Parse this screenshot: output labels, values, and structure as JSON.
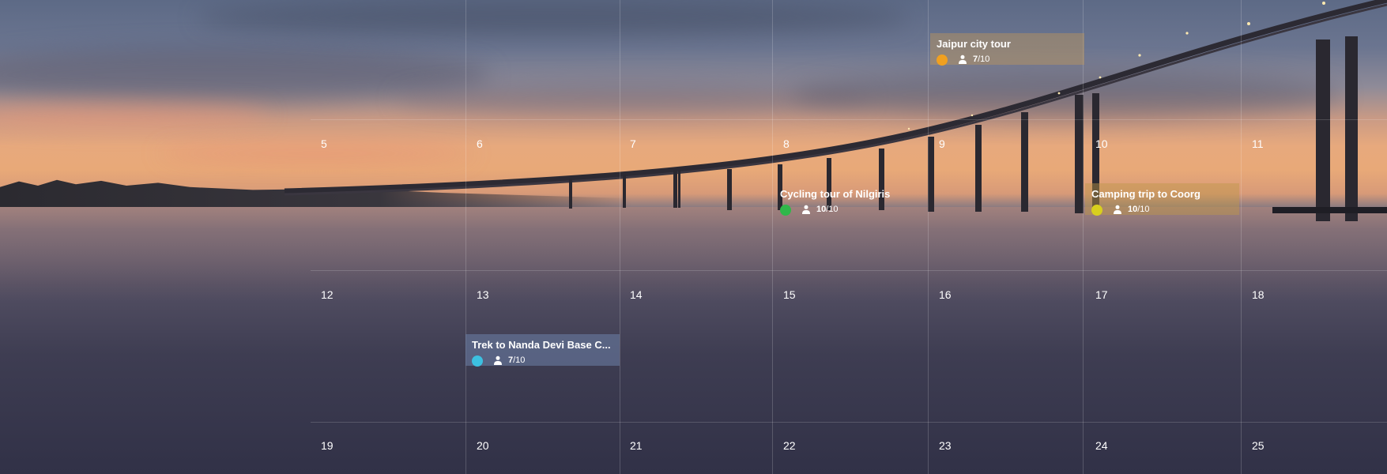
{
  "calendar": {
    "week_rows": [
      [
        "5",
        "6",
        "7",
        "8",
        "9",
        "10",
        "11"
      ],
      [
        "12",
        "13",
        "14",
        "15",
        "16",
        "17",
        "18"
      ],
      [
        "19",
        "20",
        "21",
        "22",
        "23",
        "24",
        "25"
      ]
    ]
  },
  "events": [
    {
      "title": "Jaipur city tour",
      "booked": "7",
      "capacity": "/10",
      "dot_color": "#f0a020",
      "bg": "rgba(190,150,90,.45)"
    },
    {
      "title": "Cycling tour of Nilgiris",
      "booked": "10",
      "capacity": "/10",
      "dot_color": "#2fb84a",
      "bg": "rgba(0,0,0,0)"
    },
    {
      "title": "Camping trip to Coorg",
      "booked": "10",
      "capacity": "/10",
      "dot_color": "#d8cf1e",
      "bg": "rgba(190,150,70,.45)"
    },
    {
      "title": "Trek to Nanda Devi Base C...",
      "booked": "7",
      "capacity": "/10",
      "dot_color": "#3cc0e0",
      "bg": "rgba(110,130,170,.55)"
    }
  ],
  "icons": {
    "participants": "person-icon"
  }
}
